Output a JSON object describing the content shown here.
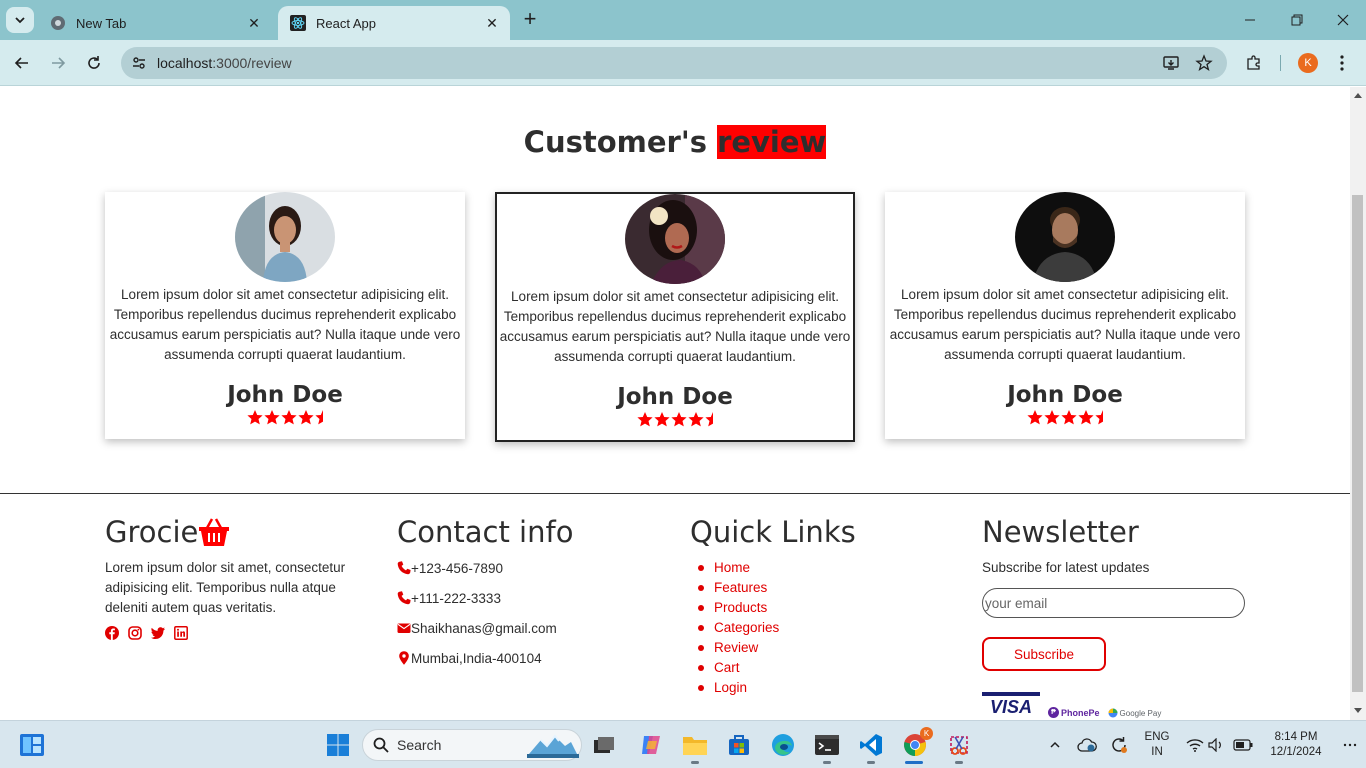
{
  "browser": {
    "tabs": [
      {
        "title": "New Tab",
        "active": false,
        "icon": "chrome-icon"
      },
      {
        "title": "React App",
        "active": true,
        "icon": "react-icon"
      }
    ],
    "url_host": "localhost",
    "url_path": ":3000/review",
    "profile_initial": "K"
  },
  "page": {
    "heading_main": "Customer's ",
    "heading_highlight": "review",
    "accent_color": "#ff0000",
    "reviews": [
      {
        "text": "Lorem ipsum dolor sit amet consectetur adipisicing elit. Temporibus repellendus ducimus reprehenderit explicabo accusamus earum perspiciatis aut? Nulla itaque unde vero assumenda corrupti quaerat laudantium.",
        "name": "John Doe",
        "rating": 4.5
      },
      {
        "text": "Lorem ipsum dolor sit amet consectetur adipisicing elit. Temporibus repellendus ducimus reprehenderit explicabo accusamus earum perspiciatis aut? Nulla itaque unde vero assumenda corrupti quaerat laudantium.",
        "name": "John Doe",
        "rating": 4.5
      },
      {
        "text": "Lorem ipsum dolor sit amet consectetur adipisicing elit. Temporibus repellendus ducimus reprehenderit explicabo accusamus earum perspiciatis aut? Nulla itaque unde vero assumenda corrupti quaerat laudantium.",
        "name": "John Doe",
        "rating": 4.5
      }
    ]
  },
  "footer": {
    "brand": "Grocie",
    "brand_desc": "Lorem ipsum dolor sit amet, consectetur adipisicing elit. Temporibus nulla atque deleniti autem quas veritatis.",
    "socials": [
      "facebook-icon",
      "instagram-icon",
      "twitter-icon",
      "linkedin-icon"
    ],
    "contact_title": "Contact info",
    "contacts": [
      {
        "icon": "phone-icon",
        "text": "+123-456-7890"
      },
      {
        "icon": "phone-icon",
        "text": "+111-222-3333"
      },
      {
        "icon": "envelope-icon",
        "text": "Shaikhanas@gmail.com"
      },
      {
        "icon": "map-pin-icon",
        "text": "Mumbai,India-400104"
      }
    ],
    "links_title": "Quick Links",
    "links": [
      "Home",
      "Features",
      "Products",
      "Categories",
      "Review",
      "Cart",
      "Login"
    ],
    "newsletter_title": "Newsletter",
    "newsletter_sub": "Subscribe for latest updates",
    "email_placeholder": "your email",
    "subscribe_label": "Subscribe",
    "payments": {
      "visa": "VISA",
      "phonepe": "PhonePe",
      "gpay": "Google Pay"
    }
  },
  "taskbar": {
    "search_label": "Search",
    "lang_line1": "ENG",
    "lang_line2": "IN",
    "time": "8:14 PM",
    "date": "12/1/2024"
  }
}
